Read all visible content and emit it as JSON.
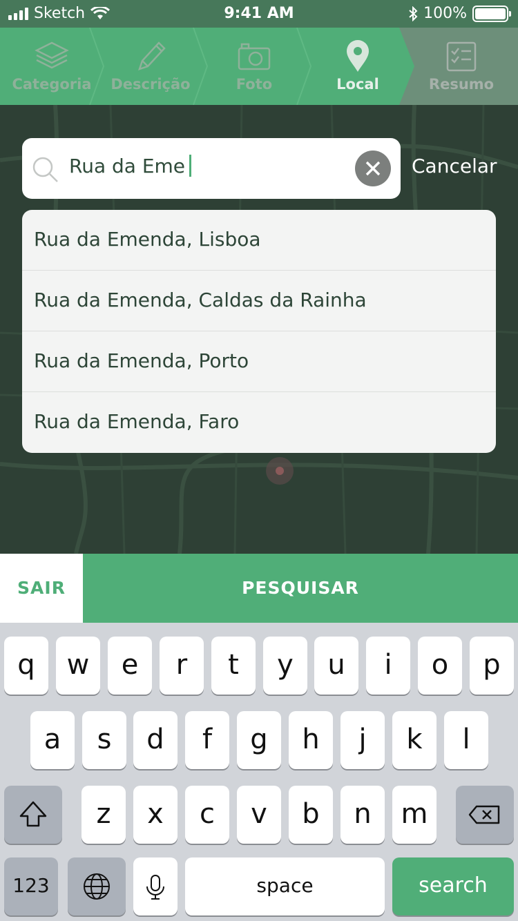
{
  "status_bar": {
    "carrier": "Sketch",
    "time": "9:41 AM",
    "battery_percent": "100%",
    "signal_icon": "signal-bars-icon",
    "wifi_icon": "wifi-icon",
    "bluetooth_icon": "bluetooth-icon",
    "battery_level": 1.0
  },
  "steps": [
    {
      "label": "Categoria",
      "icon": "layers-icon",
      "state": "done"
    },
    {
      "label": "Descrição",
      "icon": "pencil-icon",
      "state": "done"
    },
    {
      "label": "Foto",
      "icon": "camera-icon",
      "state": "done"
    },
    {
      "label": "Local",
      "icon": "map-pin-icon",
      "state": "active"
    },
    {
      "label": "Resumo",
      "icon": "clipboard-icon",
      "state": "pending"
    }
  ],
  "search": {
    "value": "Rua da Eme",
    "icon": "search-icon",
    "clear_icon": "clear-icon",
    "cancel_label": "Cancelar"
  },
  "suggestions": [
    "Rua da Emenda, Lisboa",
    "Rua da Emenda, Caldas da Rainha",
    "Rua da Emenda, Porto",
    "Rua da Emenda, Faro"
  ],
  "actions": {
    "exit_label": "SAIR",
    "search_label": "PESQUISAR"
  },
  "keyboard": {
    "row1": [
      "q",
      "w",
      "e",
      "r",
      "t",
      "y",
      "u",
      "i",
      "o",
      "p"
    ],
    "row2": [
      "a",
      "s",
      "d",
      "f",
      "g",
      "h",
      "j",
      "k",
      "l"
    ],
    "row3": [
      "z",
      "x",
      "c",
      "v",
      "b",
      "n",
      "m"
    ],
    "numbers_label": "123",
    "space_label": "space",
    "search_label": "search",
    "shift_icon": "shift-icon",
    "backspace_icon": "backspace-icon",
    "globe_icon": "globe-icon",
    "mic_icon": "microphone-icon"
  },
  "colors": {
    "brand_green": "#50ae78",
    "header_green": "#47785a",
    "map_dark": "#2f4236"
  }
}
